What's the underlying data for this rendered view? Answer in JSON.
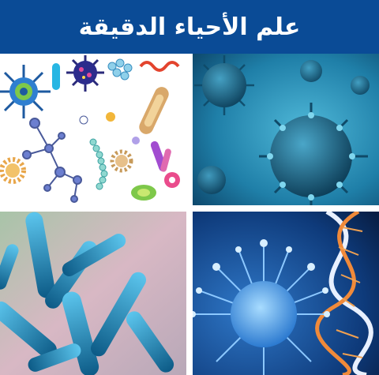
{
  "banner": {
    "title": "علم الأحياء الدقيقة",
    "background_color": "#0a4b96",
    "text_color": "#ffffff"
  },
  "images": [
    {
      "name": "microbes-illustration-icon"
    },
    {
      "name": "virus-particles-image"
    },
    {
      "name": "rod-bacteria-image"
    },
    {
      "name": "virus-dna-helix-image"
    }
  ]
}
